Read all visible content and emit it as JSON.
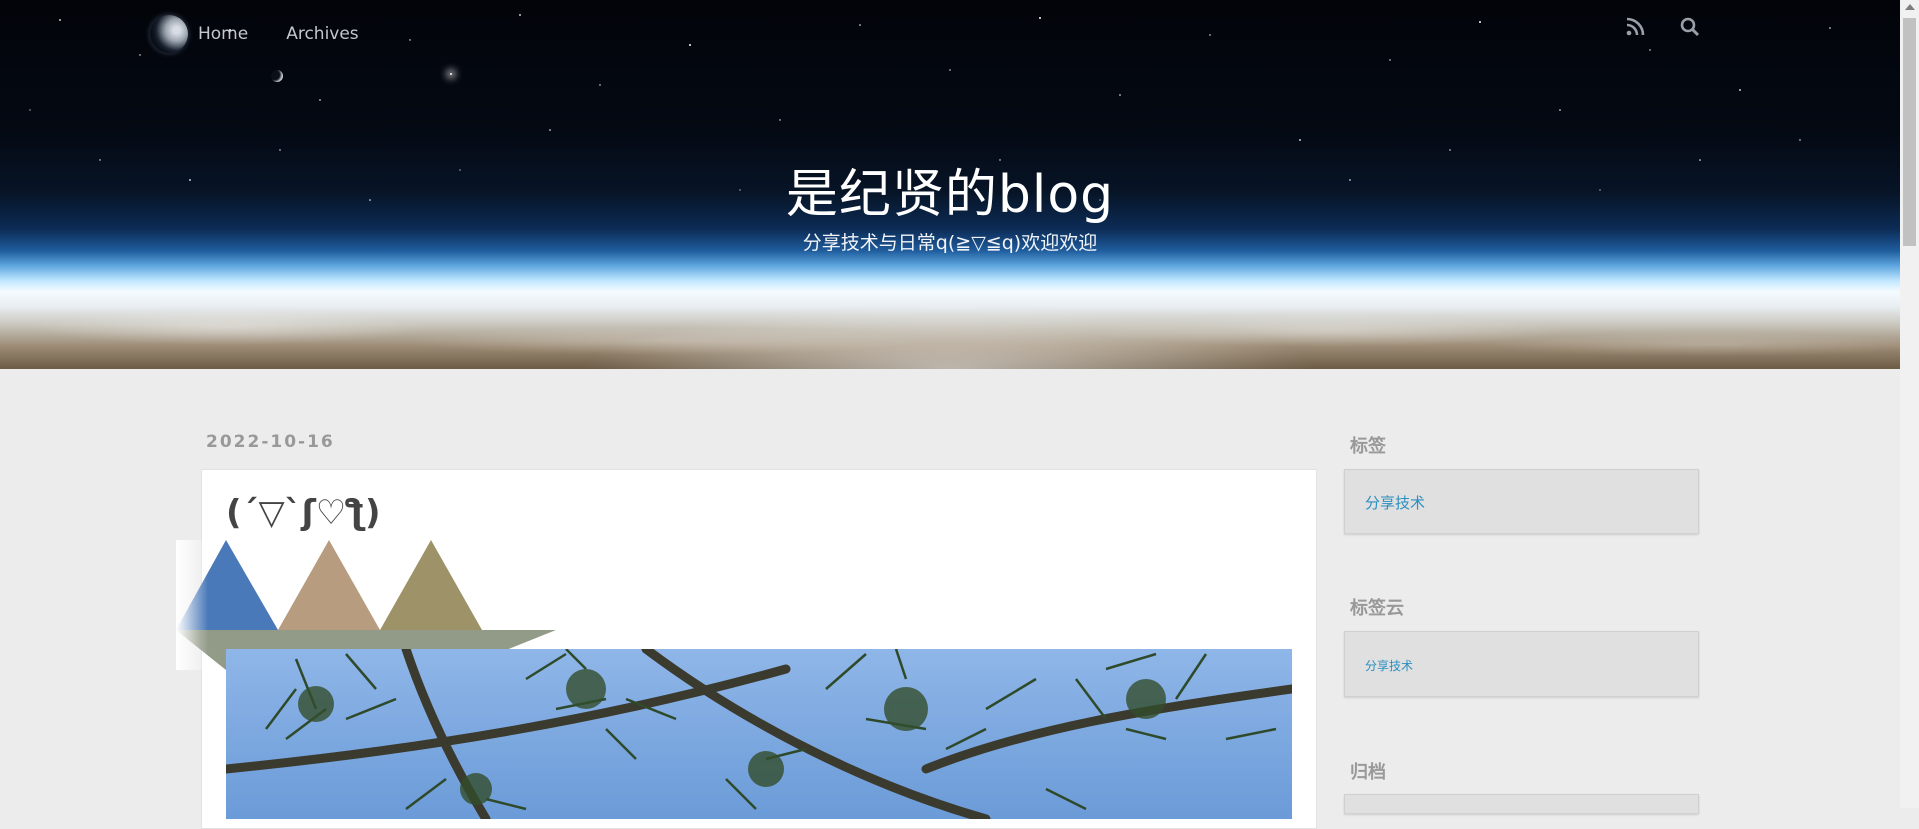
{
  "nav": {
    "links": [
      "Home",
      "Archives"
    ],
    "icons": [
      "rss-icon",
      "search-icon"
    ]
  },
  "header": {
    "title": "是纪贤的blog",
    "subtitle": "分享技术与日常q(≧▽≦q)欢迎欢迎"
  },
  "post": {
    "date": "2022-10-16",
    "title": "(´▽`ʃ♡ƪ)",
    "triangle_colors": [
      "#4a79b9",
      "#b89c80",
      "#9e9368"
    ]
  },
  "sidebar": {
    "tags": {
      "title": "标签",
      "items": [
        "分享技术"
      ]
    },
    "tag_cloud": {
      "title": "标签云",
      "items": [
        "分享技术"
      ]
    },
    "archives": {
      "title": "归档"
    }
  },
  "colors": {
    "link": "#2a8fc1",
    "page_background": "#ececec"
  }
}
